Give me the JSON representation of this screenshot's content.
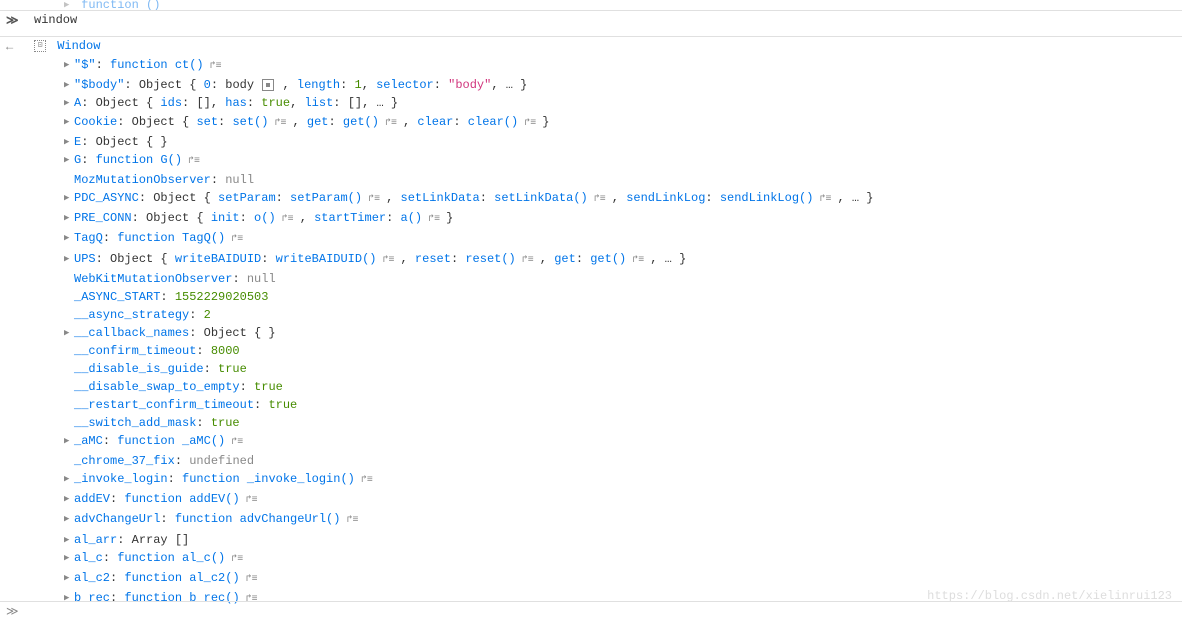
{
  "topPartial": {
    "tw": "▶",
    "key": "function ()"
  },
  "input": {
    "prompt": "≫",
    "text": "window"
  },
  "result": {
    "backArrow": "←",
    "badge": "⊡",
    "label": "Window"
  },
  "rows": [
    {
      "tw": "▶",
      "parts": [
        {
          "t": "key",
          "v": "\"$\""
        },
        {
          "t": "sep",
          "v": ": "
        },
        {
          "t": "func",
          "v": "function ct()"
        },
        {
          "t": "jump",
          "v": " ↱≡"
        }
      ]
    },
    {
      "tw": "▶",
      "parts": [
        {
          "t": "key",
          "v": "\"$body\""
        },
        {
          "t": "sep",
          "v": ": "
        },
        {
          "t": "obj",
          "v": "Object { "
        },
        {
          "t": "key",
          "v": "0"
        },
        {
          "t": "sep",
          "v": ": "
        },
        {
          "t": "plain",
          "v": "body "
        },
        {
          "t": "target",
          "v": ""
        },
        {
          "t": "sep",
          "v": " , "
        },
        {
          "t": "key",
          "v": "length"
        },
        {
          "t": "sep",
          "v": ": "
        },
        {
          "t": "num",
          "v": "1"
        },
        {
          "t": "sep",
          "v": ", "
        },
        {
          "t": "key",
          "v": "selector"
        },
        {
          "t": "sep",
          "v": ": "
        },
        {
          "t": "string",
          "v": "\"body\""
        },
        {
          "t": "sep",
          "v": ", … }"
        }
      ]
    },
    {
      "tw": "▶",
      "parts": [
        {
          "t": "key",
          "v": "A"
        },
        {
          "t": "sep",
          "v": ": "
        },
        {
          "t": "obj",
          "v": "Object { "
        },
        {
          "t": "key",
          "v": "ids"
        },
        {
          "t": "sep",
          "v": ": "
        },
        {
          "t": "plain",
          "v": "[]"
        },
        {
          "t": "sep",
          "v": ", "
        },
        {
          "t": "key",
          "v": "has"
        },
        {
          "t": "sep",
          "v": ": "
        },
        {
          "t": "bool",
          "v": "true"
        },
        {
          "t": "sep",
          "v": ", "
        },
        {
          "t": "key",
          "v": "list"
        },
        {
          "t": "sep",
          "v": ": "
        },
        {
          "t": "plain",
          "v": "[]"
        },
        {
          "t": "sep",
          "v": ", … }"
        }
      ]
    },
    {
      "tw": "▶",
      "parts": [
        {
          "t": "key",
          "v": "Cookie"
        },
        {
          "t": "sep",
          "v": ": "
        },
        {
          "t": "obj",
          "v": "Object { "
        },
        {
          "t": "key",
          "v": "set"
        },
        {
          "t": "sep",
          "v": ": "
        },
        {
          "t": "func",
          "v": "set()"
        },
        {
          "t": "jump",
          "v": " ↱≡ "
        },
        {
          "t": "sep",
          "v": ", "
        },
        {
          "t": "key",
          "v": "get"
        },
        {
          "t": "sep",
          "v": ": "
        },
        {
          "t": "func",
          "v": "get()"
        },
        {
          "t": "jump",
          "v": " ↱≡ "
        },
        {
          "t": "sep",
          "v": ", "
        },
        {
          "t": "key",
          "v": "clear"
        },
        {
          "t": "sep",
          "v": ": "
        },
        {
          "t": "func",
          "v": "clear()"
        },
        {
          "t": "jump",
          "v": " ↱≡ "
        },
        {
          "t": "sep",
          "v": " }"
        }
      ]
    },
    {
      "tw": "▶",
      "parts": [
        {
          "t": "key",
          "v": "E"
        },
        {
          "t": "sep",
          "v": ": "
        },
        {
          "t": "obj",
          "v": "Object {  }"
        }
      ]
    },
    {
      "tw": "▶",
      "parts": [
        {
          "t": "key",
          "v": "G"
        },
        {
          "t": "sep",
          "v": ": "
        },
        {
          "t": "func",
          "v": "function G()"
        },
        {
          "t": "jump",
          "v": " ↱≡"
        }
      ]
    },
    {
      "tw": "",
      "parts": [
        {
          "t": "key",
          "v": "MozMutationObserver"
        },
        {
          "t": "sep",
          "v": ": "
        },
        {
          "t": "null",
          "v": "null"
        }
      ]
    },
    {
      "tw": "▶",
      "parts": [
        {
          "t": "key",
          "v": "PDC_ASYNC"
        },
        {
          "t": "sep",
          "v": ": "
        },
        {
          "t": "obj",
          "v": "Object { "
        },
        {
          "t": "key",
          "v": "setParam"
        },
        {
          "t": "sep",
          "v": ": "
        },
        {
          "t": "func",
          "v": "setParam()"
        },
        {
          "t": "jump",
          "v": " ↱≡ "
        },
        {
          "t": "sep",
          "v": ", "
        },
        {
          "t": "key",
          "v": "setLinkData"
        },
        {
          "t": "sep",
          "v": ": "
        },
        {
          "t": "func",
          "v": "setLinkData()"
        },
        {
          "t": "jump",
          "v": " ↱≡ "
        },
        {
          "t": "sep",
          "v": ", "
        },
        {
          "t": "key",
          "v": "sendLinkLog"
        },
        {
          "t": "sep",
          "v": ": "
        },
        {
          "t": "func",
          "v": "sendLinkLog()"
        },
        {
          "t": "jump",
          "v": " ↱≡ "
        },
        {
          "t": "sep",
          "v": ", … }"
        }
      ]
    },
    {
      "tw": "▶",
      "parts": [
        {
          "t": "key",
          "v": "PRE_CONN"
        },
        {
          "t": "sep",
          "v": ": "
        },
        {
          "t": "obj",
          "v": "Object { "
        },
        {
          "t": "key",
          "v": "init"
        },
        {
          "t": "sep",
          "v": ": "
        },
        {
          "t": "func",
          "v": "o()"
        },
        {
          "t": "jump",
          "v": " ↱≡ "
        },
        {
          "t": "sep",
          "v": ", "
        },
        {
          "t": "key",
          "v": "startTimer"
        },
        {
          "t": "sep",
          "v": ": "
        },
        {
          "t": "func",
          "v": "a()"
        },
        {
          "t": "jump",
          "v": " ↱≡ "
        },
        {
          "t": "sep",
          "v": " }"
        }
      ]
    },
    {
      "tw": "▶",
      "parts": [
        {
          "t": "key",
          "v": "TagQ"
        },
        {
          "t": "sep",
          "v": ": "
        },
        {
          "t": "func",
          "v": "function TagQ()"
        },
        {
          "t": "jump",
          "v": " ↱≡"
        }
      ]
    },
    {
      "tw": "▶",
      "parts": [
        {
          "t": "key",
          "v": "UPS"
        },
        {
          "t": "sep",
          "v": ": "
        },
        {
          "t": "obj",
          "v": "Object { "
        },
        {
          "t": "key",
          "v": "writeBAIDUID"
        },
        {
          "t": "sep",
          "v": ": "
        },
        {
          "t": "func",
          "v": "writeBAIDUID()"
        },
        {
          "t": "jump",
          "v": " ↱≡ "
        },
        {
          "t": "sep",
          "v": ", "
        },
        {
          "t": "key",
          "v": "reset"
        },
        {
          "t": "sep",
          "v": ": "
        },
        {
          "t": "func",
          "v": "reset()"
        },
        {
          "t": "jump",
          "v": " ↱≡ "
        },
        {
          "t": "sep",
          "v": ", "
        },
        {
          "t": "key",
          "v": "get"
        },
        {
          "t": "sep",
          "v": ": "
        },
        {
          "t": "func",
          "v": "get()"
        },
        {
          "t": "jump",
          "v": " ↱≡ "
        },
        {
          "t": "sep",
          "v": ", … }"
        }
      ]
    },
    {
      "tw": "",
      "parts": [
        {
          "t": "key",
          "v": "WebKitMutationObserver"
        },
        {
          "t": "sep",
          "v": ": "
        },
        {
          "t": "null",
          "v": "null"
        }
      ]
    },
    {
      "tw": "",
      "parts": [
        {
          "t": "key",
          "v": "_ASYNC_START"
        },
        {
          "t": "sep",
          "v": ": "
        },
        {
          "t": "num",
          "v": "1552229020503"
        }
      ]
    },
    {
      "tw": "",
      "parts": [
        {
          "t": "key",
          "v": "__async_strategy"
        },
        {
          "t": "sep",
          "v": ": "
        },
        {
          "t": "num",
          "v": "2"
        }
      ]
    },
    {
      "tw": "▶",
      "parts": [
        {
          "t": "key",
          "v": "__callback_names"
        },
        {
          "t": "sep",
          "v": ": "
        },
        {
          "t": "obj",
          "v": "Object {  }"
        }
      ]
    },
    {
      "tw": "",
      "parts": [
        {
          "t": "key",
          "v": "__confirm_timeout"
        },
        {
          "t": "sep",
          "v": ": "
        },
        {
          "t": "num",
          "v": "8000"
        }
      ]
    },
    {
      "tw": "",
      "parts": [
        {
          "t": "key",
          "v": "__disable_is_guide"
        },
        {
          "t": "sep",
          "v": ": "
        },
        {
          "t": "bool",
          "v": "true"
        }
      ]
    },
    {
      "tw": "",
      "parts": [
        {
          "t": "key",
          "v": "__disable_swap_to_empty"
        },
        {
          "t": "sep",
          "v": ": "
        },
        {
          "t": "bool",
          "v": "true"
        }
      ]
    },
    {
      "tw": "",
      "parts": [
        {
          "t": "key",
          "v": "__restart_confirm_timeout"
        },
        {
          "t": "sep",
          "v": ": "
        },
        {
          "t": "bool",
          "v": "true"
        }
      ]
    },
    {
      "tw": "",
      "parts": [
        {
          "t": "key",
          "v": "__switch_add_mask"
        },
        {
          "t": "sep",
          "v": ": "
        },
        {
          "t": "bool",
          "v": "true"
        }
      ]
    },
    {
      "tw": "▶",
      "parts": [
        {
          "t": "key",
          "v": "_aMC"
        },
        {
          "t": "sep",
          "v": ": "
        },
        {
          "t": "func",
          "v": "function _aMC()"
        },
        {
          "t": "jump",
          "v": " ↱≡"
        }
      ]
    },
    {
      "tw": "",
      "parts": [
        {
          "t": "key",
          "v": "_chrome_37_fix"
        },
        {
          "t": "sep",
          "v": ": "
        },
        {
          "t": "undef",
          "v": "undefined"
        }
      ]
    },
    {
      "tw": "▶",
      "parts": [
        {
          "t": "key",
          "v": "_invoke_login"
        },
        {
          "t": "sep",
          "v": ": "
        },
        {
          "t": "func",
          "v": "function _invoke_login()"
        },
        {
          "t": "jump",
          "v": " ↱≡"
        }
      ]
    },
    {
      "tw": "▶",
      "parts": [
        {
          "t": "key",
          "v": "addEV"
        },
        {
          "t": "sep",
          "v": ": "
        },
        {
          "t": "func",
          "v": "function addEV()"
        },
        {
          "t": "jump",
          "v": " ↱≡"
        }
      ]
    },
    {
      "tw": "▶",
      "parts": [
        {
          "t": "key",
          "v": "advChangeUrl"
        },
        {
          "t": "sep",
          "v": ": "
        },
        {
          "t": "func",
          "v": "function advChangeUrl()"
        },
        {
          "t": "jump",
          "v": " ↱≡"
        }
      ]
    },
    {
      "tw": "▶",
      "parts": [
        {
          "t": "key",
          "v": "al_arr"
        },
        {
          "t": "sep",
          "v": ": "
        },
        {
          "t": "obj",
          "v": "Array []"
        }
      ]
    },
    {
      "tw": "▶",
      "parts": [
        {
          "t": "key",
          "v": "al_c"
        },
        {
          "t": "sep",
          "v": ": "
        },
        {
          "t": "func",
          "v": "function al_c()"
        },
        {
          "t": "jump",
          "v": " ↱≡"
        }
      ]
    },
    {
      "tw": "▶",
      "parts": [
        {
          "t": "key",
          "v": "al_c2"
        },
        {
          "t": "sep",
          "v": ": "
        },
        {
          "t": "func",
          "v": "function al_c2()"
        },
        {
          "t": "jump",
          "v": " ↱≡"
        }
      ]
    },
    {
      "tw": "▶",
      "parts": [
        {
          "t": "key",
          "v": "b rec"
        },
        {
          "t": "sep",
          "v": ": "
        },
        {
          "t": "func",
          "v": "function b rec()"
        },
        {
          "t": "jump",
          "v": " ↱≡"
        }
      ]
    }
  ],
  "bottomPrompt": "≫",
  "watermark": "https://blog.csdn.net/xielinrui123"
}
